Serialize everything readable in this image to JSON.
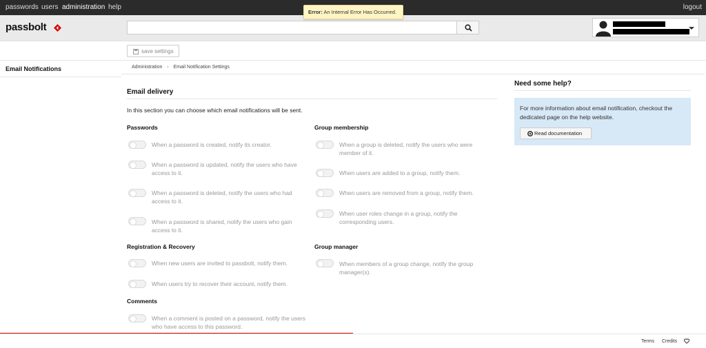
{
  "topnav": {
    "items": [
      {
        "label": "passwords"
      },
      {
        "label": "users"
      },
      {
        "label": "administration"
      },
      {
        "label": "help"
      }
    ],
    "logout_label": "logout"
  },
  "error": {
    "title": "Error:",
    "message": "An Internal Error Has Occurred."
  },
  "header": {
    "logo_text": "passbolt",
    "brand_color": "#d40101"
  },
  "toolbar": {
    "save_label": "save settings"
  },
  "sidebar": {
    "items": [
      {
        "label": "Email Notifications"
      }
    ]
  },
  "breadcrumb": {
    "items": [
      "Administration",
      "Email Notification Settings"
    ],
    "separator": "›"
  },
  "main": {
    "title": "Email delivery",
    "intro": "In this section you can choose which email notifications will be sent.",
    "sections": {
      "passwords": {
        "title": "Passwords",
        "options": [
          {
            "label": "When a password is created, notify its creator.",
            "enabled": false
          },
          {
            "label": "When a password is updated, notify the users who have access to it.",
            "enabled": false
          },
          {
            "label": "When a password is deleted, notify the users who had access to it.",
            "enabled": false
          },
          {
            "label": "When a password is shared, notify the users who gain access to it.",
            "enabled": false
          }
        ]
      },
      "registration": {
        "title": "Registration & Recovery",
        "options": [
          {
            "label": "When new users are invited to passbolt, notify them.",
            "enabled": false
          },
          {
            "label": "When users try to recover their account, notify them.",
            "enabled": false
          }
        ]
      },
      "comments": {
        "title": "Comments",
        "options": [
          {
            "label": "When a comment is posted on a password, notify the users who have access to this password.",
            "enabled": false
          }
        ]
      },
      "group_membership": {
        "title": "Group membership",
        "options": [
          {
            "label": "When a group is deleted, notify the users who were member of it.",
            "enabled": false
          },
          {
            "label": "When users are added to a group, notify them.",
            "enabled": false
          },
          {
            "label": "When users are removed from a group, notify them.",
            "enabled": false
          },
          {
            "label": "When user roles change in a group, notify the corresponding users.",
            "enabled": false
          }
        ]
      },
      "group_manager": {
        "title": "Group manager",
        "options": [
          {
            "label": "When members of a group change, notify the group manager(s).",
            "enabled": false
          }
        ]
      }
    }
  },
  "help": {
    "title": "Need some help?",
    "text": "For more information about email notification, checkout the dedicated page on the help website.",
    "button_label": "Read documentation"
  },
  "footer": {
    "terms_label": "Terms",
    "credits_label": "Credits",
    "heart_icon": "heart-icon"
  }
}
